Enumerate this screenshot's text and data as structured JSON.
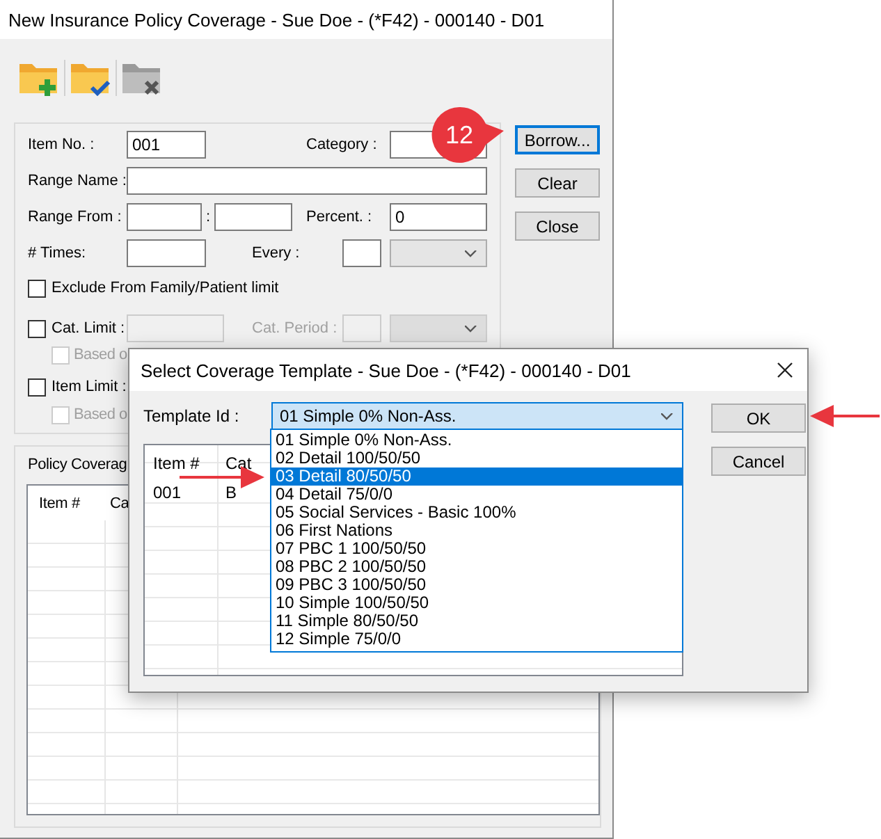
{
  "window": {
    "title": "New Insurance Policy Coverage - Sue Doe - (*F42) - 000140 - D01"
  },
  "toolbar": [
    {
      "kind": "add",
      "disabled": false
    },
    {
      "kind": "confirm",
      "disabled": false
    },
    {
      "kind": "delete",
      "disabled": true
    }
  ],
  "form": {
    "item_no": {
      "label": "Item No. :",
      "value": "001"
    },
    "category": {
      "label": "Category :"
    },
    "range_name": {
      "label": "Range Name :"
    },
    "range_from": {
      "label": "Range From :",
      "separator": ":"
    },
    "percent": {
      "label": "Percent. :",
      "value": "0"
    },
    "times": {
      "label": "# Times:"
    },
    "every": {
      "label": "Every :"
    },
    "exclude": {
      "label": "Exclude From Family/Patient limit",
      "checked": false
    },
    "cat_limit": {
      "label": "Cat. Limit :",
      "checked": false,
      "fields_disabled": true,
      "period_label": "Cat. Period :",
      "based_on": {
        "label": "Based o",
        "checked": false,
        "disabled": true
      }
    },
    "item_limit": {
      "label": "Item Limit :",
      "checked": false,
      "based_on": {
        "label": "Based o",
        "checked": false,
        "disabled": true
      }
    }
  },
  "buttons": [
    {
      "label": "Borrow...",
      "focused": true
    },
    {
      "label": "Clear",
      "focused": false
    },
    {
      "label": "Close",
      "focused": false
    }
  ],
  "callout": {
    "text": "12"
  },
  "policy_coverage": {
    "title": "Policy Coverag",
    "columns": [
      "Item #",
      "Ca"
    ]
  },
  "dialog": {
    "title": "Select Coverage Template - Sue Doe - (*F42) - 000140 - D01",
    "template_label": "Template Id :",
    "template_value": "01 Simple 0% Non-Ass.",
    "options": [
      {
        "label": "01 Simple 0% Non-Ass.",
        "selected": false
      },
      {
        "label": "02 Detail 100/50/50",
        "selected": false
      },
      {
        "label": "03 Detail 80/50/50",
        "selected": true
      },
      {
        "label": "04 Detail 75/0/0",
        "selected": false
      },
      {
        "label": "05 Social Services - Basic 100%",
        "selected": false
      },
      {
        "label": "06 First Nations",
        "selected": false
      },
      {
        "label": "07 PBC 1 100/50/50",
        "selected": false
      },
      {
        "label": "08 PBC 2 100/50/50",
        "selected": false
      },
      {
        "label": "09 PBC 3 100/50/50",
        "selected": false
      },
      {
        "label": "10 Simple 100/50/50",
        "selected": false
      },
      {
        "label": "11 Simple 80/50/50",
        "selected": false
      },
      {
        "label": "12 Simple 75/0/0",
        "selected": false
      }
    ],
    "columns": [
      "Item #",
      "Cat"
    ],
    "rows": [
      [
        "001",
        "B"
      ]
    ],
    "buttons": [
      {
        "label": "OK",
        "focused": false
      },
      {
        "label": "Cancel",
        "focused": false
      }
    ]
  }
}
